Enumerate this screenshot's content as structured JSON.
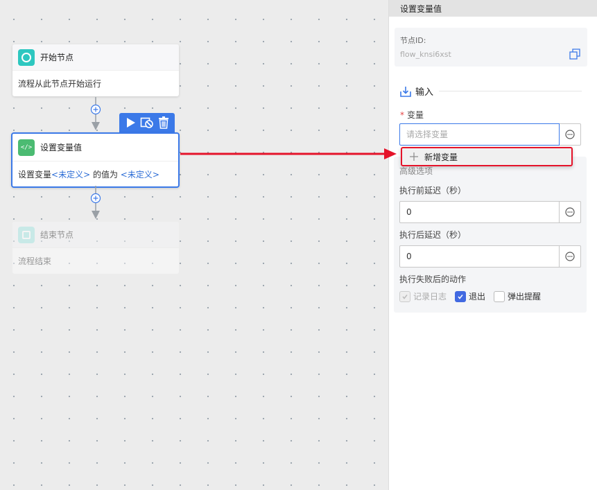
{
  "canvas": {
    "start_node": {
      "title": "开始节点",
      "description": "流程从此节点开始运行",
      "icon": "circle-icon"
    },
    "set_node": {
      "title": "设置变量值",
      "desc_prefix": "设置变量 ",
      "var_a": "<未定义>",
      "desc_mid": " 的值为 ",
      "var_b": "<未定义>",
      "icon": "code-icon",
      "toolbar": [
        "play-icon",
        "disable-icon",
        "trash-icon"
      ]
    },
    "end_node": {
      "title": "结束节点",
      "description": "流程结束",
      "icon": "square-icon"
    }
  },
  "panel": {
    "title": "设置变量值",
    "node_id_label": "节点ID:",
    "node_id_value": "flow_knsi6xst",
    "input_section": "输入",
    "variable_label": "变量",
    "variable_placeholder": "请选择变量",
    "dropdown_item": "新增变量",
    "advanced_label": "高级选项",
    "delay_before_label": "执行前延迟（秒）",
    "delay_before_value": "0",
    "delay_after_label": "执行后延迟（秒）",
    "delay_after_value": "0",
    "on_fail_label": "执行失败后的动作",
    "on_fail_options": [
      {
        "label": "记录日志",
        "checked": true,
        "disabled": true
      },
      {
        "label": "退出",
        "checked": true,
        "disabled": false
      },
      {
        "label": "弹出提醒",
        "checked": false,
        "disabled": false
      }
    ]
  },
  "colors": {
    "accent": "#3b79e8",
    "annotation": "#e5132a",
    "start": "#2ec7c0",
    "set": "#4bbb72"
  }
}
